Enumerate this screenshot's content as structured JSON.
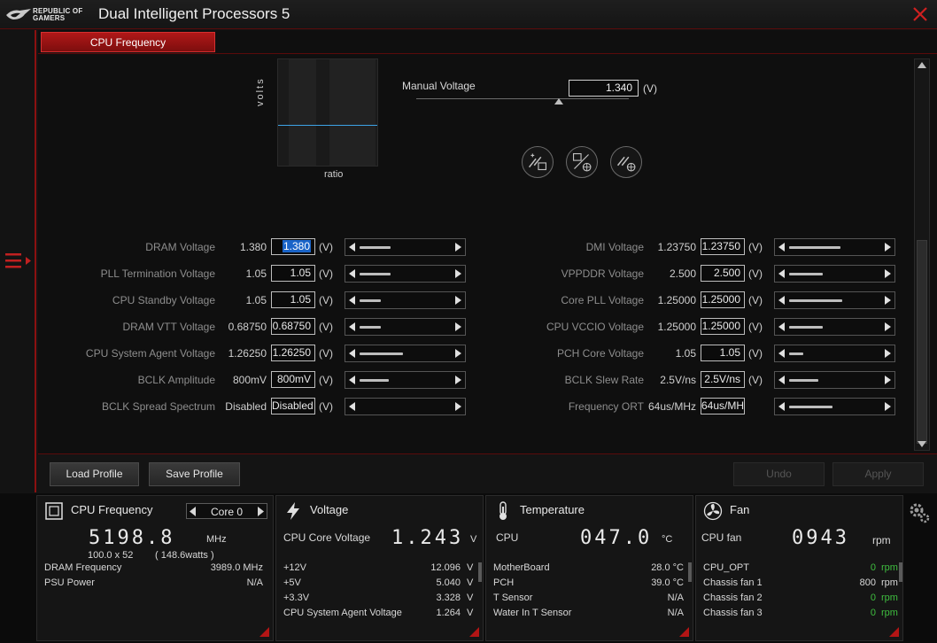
{
  "app": {
    "title": "Dual Intelligent Processors 5",
    "brand_line1": "REPUBLIC OF",
    "brand_line2": "GAMERS"
  },
  "tab": {
    "label": "CPU Frequency"
  },
  "graph": {
    "ylabel": "volts",
    "xlabel": "ratio"
  },
  "manual_voltage": {
    "label": "Manual Voltage",
    "value": "1.340",
    "unit": "(V)",
    "slider_fraction": 0.67
  },
  "left_rows": [
    {
      "label": "DRAM Voltage",
      "current": "1.380",
      "value": "1.380",
      "unit": "(V)",
      "level": 0.33,
      "selected": true
    },
    {
      "label": "PLL Termination Voltage",
      "current": "1.05",
      "value": "1.05",
      "unit": "(V)",
      "level": 0.33
    },
    {
      "label": "CPU Standby Voltage",
      "current": "1.05",
      "value": "1.05",
      "unit": "(V)",
      "level": 0.23
    },
    {
      "label": "DRAM VTT Voltage",
      "current": "0.68750",
      "value": "0.68750",
      "unit": "(V)",
      "level": 0.23
    },
    {
      "label": "CPU System Agent Voltage",
      "current": "1.26250",
      "value": "1.26250",
      "unit": "(V)",
      "level": 0.47
    },
    {
      "label": "BCLK Amplitude",
      "current": "800mV",
      "value": "800mV",
      "unit": "(V)",
      "level": 0.31
    },
    {
      "label": "BCLK Spread Spectrum",
      "current": "Disabled",
      "value": "Disabled",
      "unit": "(V)",
      "level": 0
    }
  ],
  "right_rows": [
    {
      "label": "DMI Voltage",
      "current": "1.23750",
      "value": "1.23750",
      "unit": "(V)",
      "level": 0.55
    },
    {
      "label": "VPPDDR Voltage",
      "current": "2.500",
      "value": "2.500",
      "unit": "(V)",
      "level": 0.36
    },
    {
      "label": "Core PLL Voltage",
      "current": "1.25000",
      "value": "1.25000",
      "unit": "(V)",
      "level": 0.57
    },
    {
      "label": "CPU VCCIO Voltage",
      "current": "1.25000",
      "value": "1.25000",
      "unit": "(V)",
      "level": 0.36
    },
    {
      "label": "PCH Core Voltage",
      "current": "1.05",
      "value": "1.05",
      "unit": "(V)",
      "level": 0.15
    },
    {
      "label": "BCLK Slew Rate",
      "current": "2.5V/ns",
      "value": "2.5V/ns",
      "unit": "(V)",
      "level": 0.31
    },
    {
      "label": "Frequency ORT",
      "current": "64us/MHz",
      "value": "64us/MH:",
      "unit": "",
      "level": 0.47
    }
  ],
  "buttons": {
    "load": "Load Profile",
    "save": "Save Profile",
    "undo": "Undo",
    "apply": "Apply"
  },
  "cpu_panel": {
    "title": "CPU Frequency",
    "core": "Core 0",
    "freq": "5198.8",
    "freq_unit": "MHz",
    "multiplier": "100.0  x  52",
    "watts": "( 148.6watts )",
    "rows": [
      {
        "label": "DRAM Frequency",
        "value": "3989.0  MHz"
      },
      {
        "label": "PSU Power",
        "value": "N/A"
      }
    ]
  },
  "voltage_panel": {
    "title": "Voltage",
    "main_label": "CPU Core Voltage",
    "main_value": "1.243",
    "main_unit": "V",
    "rows": [
      {
        "label": "+12V",
        "value": "12.096",
        "unit": "V"
      },
      {
        "label": "+5V",
        "value": "5.040",
        "unit": "V"
      },
      {
        "label": "+3.3V",
        "value": "3.328",
        "unit": "V"
      },
      {
        "label": "CPU System Agent Voltage",
        "value": "1.264",
        "unit": "V"
      }
    ]
  },
  "temp_panel": {
    "title": "Temperature",
    "main_label": "CPU",
    "main_value": "047.0",
    "main_unit": "°C",
    "rows": [
      {
        "label": "MotherBoard",
        "value": "28.0 °C"
      },
      {
        "label": "PCH",
        "value": "39.0 °C"
      },
      {
        "label": "T Sensor",
        "value": "N/A"
      },
      {
        "label": "Water In T Sensor",
        "value": "N/A"
      }
    ]
  },
  "fan_panel": {
    "title": "Fan",
    "main_label": "CPU fan",
    "main_value": "0943",
    "main_unit": "rpm",
    "rows": [
      {
        "label": "CPU_OPT",
        "value": "0",
        "unit": "rpm",
        "green": true
      },
      {
        "label": "Chassis fan 1",
        "value": "800",
        "unit": "rpm",
        "green": false
      },
      {
        "label": "Chassis fan 2",
        "value": "0",
        "unit": "rpm",
        "green": true
      },
      {
        "label": "Chassis fan 3",
        "value": "0",
        "unit": "rpm",
        "green": true
      }
    ]
  },
  "colors": {
    "accent": "#b01818",
    "selection": "#1a64c8",
    "graph_line": "#3da3e6",
    "ok_green": "#3fbf3f"
  }
}
